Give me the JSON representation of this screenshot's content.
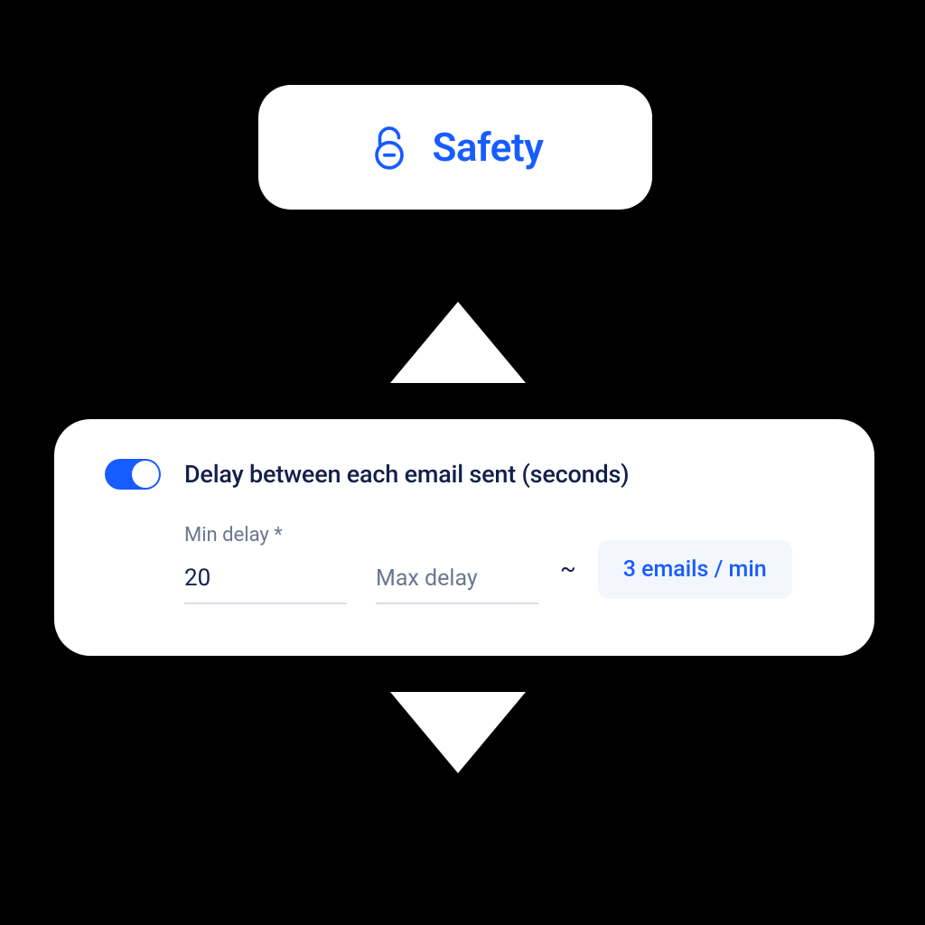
{
  "header": {
    "label": "Safety"
  },
  "card": {
    "toggle_on": true,
    "title": "Delay between each email sent (seconds)",
    "min": {
      "label": "Min delay *",
      "value": "20"
    },
    "max": {
      "placeholder": "Max delay",
      "value": ""
    },
    "approx_symbol": "~",
    "rate": "3 emails / min"
  }
}
